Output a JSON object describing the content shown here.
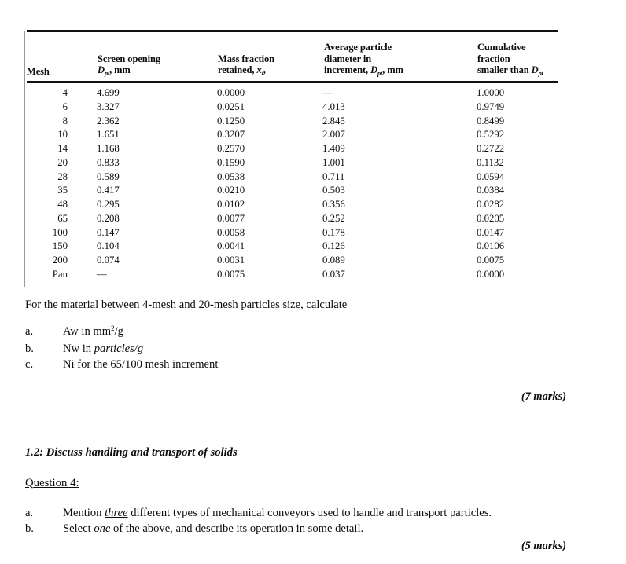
{
  "table": {
    "headers": {
      "mesh": "Mesh",
      "screen_opening_line1": "Screen opening",
      "screen_opening_line2_unit": ", mm",
      "mass_fraction_line1": "Mass fraction",
      "mass_fraction_line2": "retained, ",
      "mass_fraction_sym": "x",
      "mass_fraction_sub": "i",
      "mass_fraction_tail": ",",
      "avg_line1": "Average particle",
      "avg_line2": "diameter in",
      "avg_line3": "increment, ",
      "avg_unit": ", mm",
      "cum_line1": "Cumulative",
      "cum_line2": "fraction",
      "cum_line3": "smaller than "
    },
    "rows": [
      {
        "mesh": "4",
        "opening": "4.699",
        "mass": "0.0000",
        "avg": "—",
        "cum": "1.0000"
      },
      {
        "mesh": "6",
        "opening": "3.327",
        "mass": "0.0251",
        "avg": "4.013",
        "cum": "0.9749"
      },
      {
        "mesh": "8",
        "opening": "2.362",
        "mass": "0.1250",
        "avg": "2.845",
        "cum": "0.8499"
      },
      {
        "mesh": "10",
        "opening": "1.651",
        "mass": "0.3207",
        "avg": "2.007",
        "cum": "0.5292"
      },
      {
        "mesh": "14",
        "opening": "1.168",
        "mass": "0.2570",
        "avg": "1.409",
        "cum": "0.2722"
      },
      {
        "mesh": "20",
        "opening": "0.833",
        "mass": "0.1590",
        "avg": "1.001",
        "cum": "0.1132"
      },
      {
        "mesh": "28",
        "opening": "0.589",
        "mass": "0.0538",
        "avg": "0.711",
        "cum": "0.0594"
      },
      {
        "mesh": "35",
        "opening": "0.417",
        "mass": "0.0210",
        "avg": "0.503",
        "cum": "0.0384"
      },
      {
        "mesh": "48",
        "opening": "0.295",
        "mass": "0.0102",
        "avg": "0.356",
        "cum": "0.0282"
      },
      {
        "mesh": "65",
        "opening": "0.208",
        "mass": "0.0077",
        "avg": "0.252",
        "cum": "0.0205"
      },
      {
        "mesh": "100",
        "opening": "0.147",
        "mass": "0.0058",
        "avg": "0.178",
        "cum": "0.0147"
      },
      {
        "mesh": "150",
        "opening": "0.104",
        "mass": "0.0041",
        "avg": "0.126",
        "cum": "0.0106"
      },
      {
        "mesh": "200",
        "opening": "0.074",
        "mass": "0.0031",
        "avg": "0.089",
        "cum": "0.0075"
      },
      {
        "mesh": "Pan",
        "opening": "—",
        "mass": "0.0075",
        "avg": "0.037",
        "cum": "0.0000"
      }
    ]
  },
  "question_3": {
    "intro": "For the material between 4-mesh and 20-mesh particles size, calculate",
    "items": [
      {
        "label": "a.",
        "pre": "Aw in mm",
        "sup": "2",
        "post": "/g"
      },
      {
        "label": "b.",
        "pre": "Nw in ",
        "em": "particles/g",
        "post": ""
      },
      {
        "label": "c.",
        "pre": "Ni for the 65/100 mesh increment",
        "post": ""
      }
    ],
    "marks": "(7 marks)"
  },
  "section": {
    "heading": "1.2: Discuss handling and transport of solids",
    "question_label": "Question 4:"
  },
  "question_4": {
    "item_a": {
      "label": "a.",
      "pre": "Mention ",
      "emph": "three",
      "post": " different types of mechanical conveyors used to handle and transport particles."
    },
    "item_b": {
      "label": "b.",
      "pre": "Select ",
      "emph": "one",
      "post": " of the above, and describe its operation in some detail."
    },
    "marks": "(5 marks)"
  },
  "symbols": {
    "D": "D",
    "pi_sub": "pi"
  }
}
